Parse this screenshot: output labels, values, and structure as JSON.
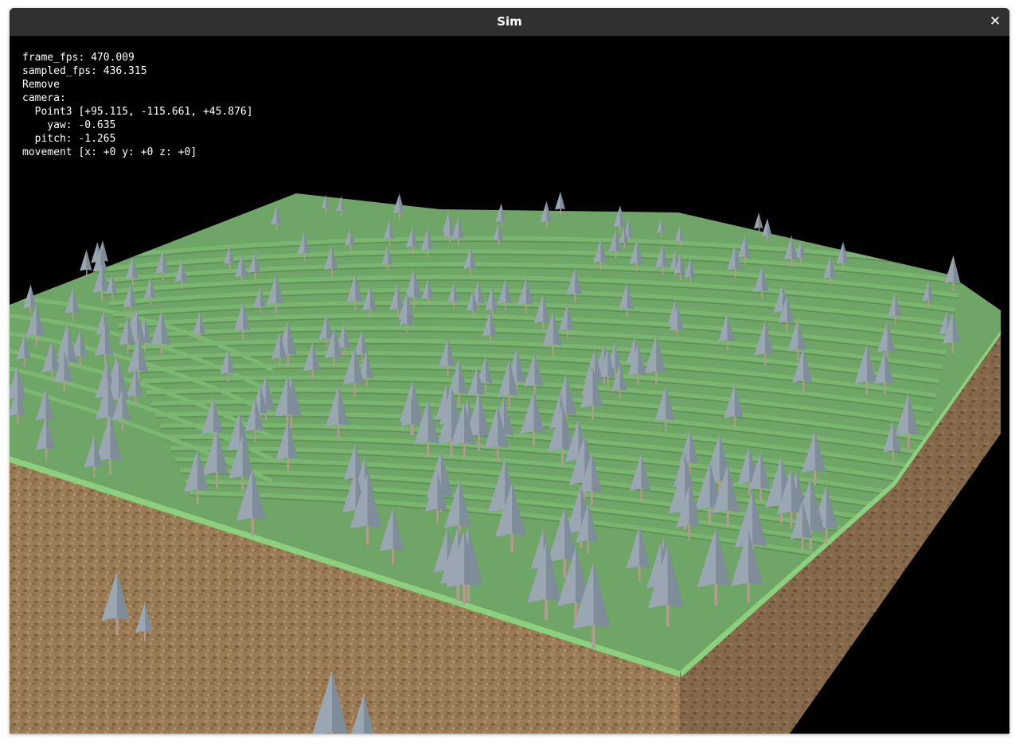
{
  "window": {
    "title": "Sim",
    "close_glyph": "✕"
  },
  "hud": {
    "frame_fps": "frame_fps: 470.009",
    "sampled_fps": "sampled_fps: 436.315",
    "mode": "Remove",
    "camera_label": "camera:",
    "camera_point": "  Point3 [+95.115, -115.661, +45.876]",
    "camera_yaw": "    yaw: -0.635",
    "camera_pitch": "  pitch: -1.265",
    "movement": "movement [x: +0 y: +0 z: +0]"
  },
  "scene": {
    "colors": {
      "background": "#000000",
      "grass": "#6fa566",
      "grass_light": "#7cb872",
      "grass_edge": "#8ccf7e",
      "dirt": "#9a7b55",
      "dirt_dark": "#7d6242",
      "tree_foliage": "#9aa7b3",
      "tree_foliage_dark": "#7f8c99",
      "tree_trunk": "#b39a8e"
    }
  }
}
